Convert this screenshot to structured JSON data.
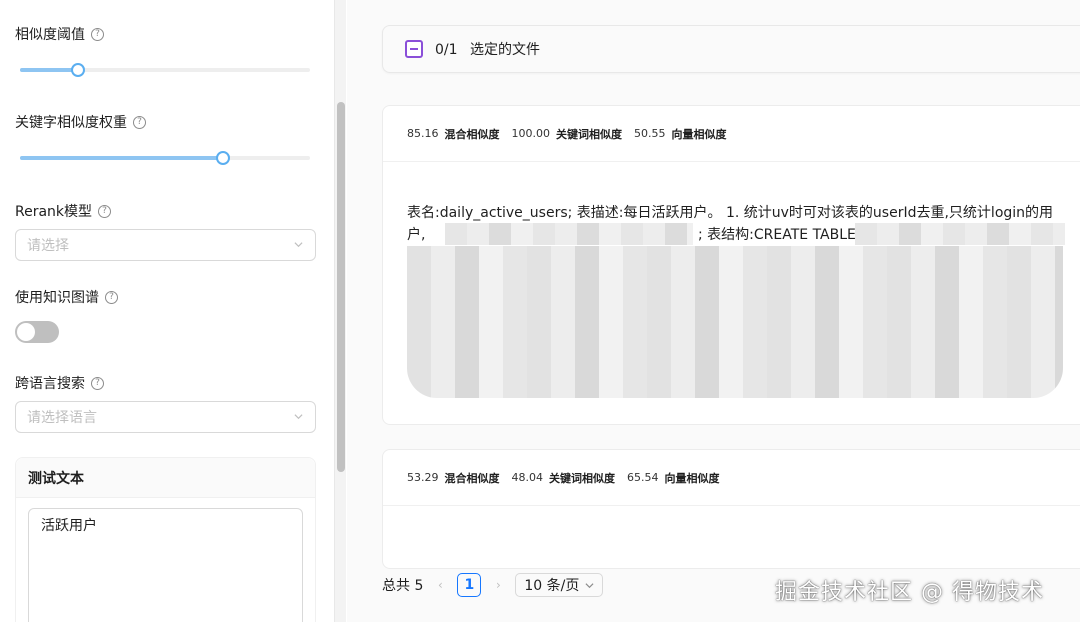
{
  "settings": {
    "similarity_threshold": {
      "label": "相似度阈值",
      "value": 0.2
    },
    "keyword_weight": {
      "label": "关键字相似度权重",
      "value": 0.7
    },
    "rerank": {
      "label": "Rerank模型",
      "placeholder": "请选择"
    },
    "knowledge_graph": {
      "label": "使用知识图谱",
      "enabled": false
    },
    "cross_language": {
      "label": "跨语言搜索",
      "placeholder": "请选择语言"
    },
    "test_text": {
      "title": "测试文本",
      "value": "活跃用户"
    }
  },
  "selection": {
    "count": "0/1",
    "label": "选定的文件"
  },
  "results": [
    {
      "hybrid_score": "85.16",
      "hybrid_label": "混合相似度",
      "keyword_score": "100.00",
      "keyword_label": "关键词相似度",
      "vector_score": "50.55",
      "vector_label": "向量相似度",
      "text_line1": "表名:daily_active_users; 表描述:每日活跃用户。 1. 统计uv时可对该表的userId去重,只统计login的用",
      "text_line2_a": "户,",
      "text_line2_b": "; 表结构:CREATE TABLE"
    },
    {
      "hybrid_score": "53.29",
      "hybrid_label": "混合相似度",
      "keyword_score": "48.04",
      "keyword_label": "关键词相似度",
      "vector_score": "65.54",
      "vector_label": "向量相似度"
    }
  ],
  "pagination": {
    "total_label": "总共 5",
    "current_page": "1",
    "page_size": "10 条/页"
  },
  "watermark": "掘金技术社区 @ 得物技术",
  "colors": {
    "accent": "#1677ff",
    "slider_fill": "#8ec5f2",
    "checkbox": "#8a4fd8"
  }
}
